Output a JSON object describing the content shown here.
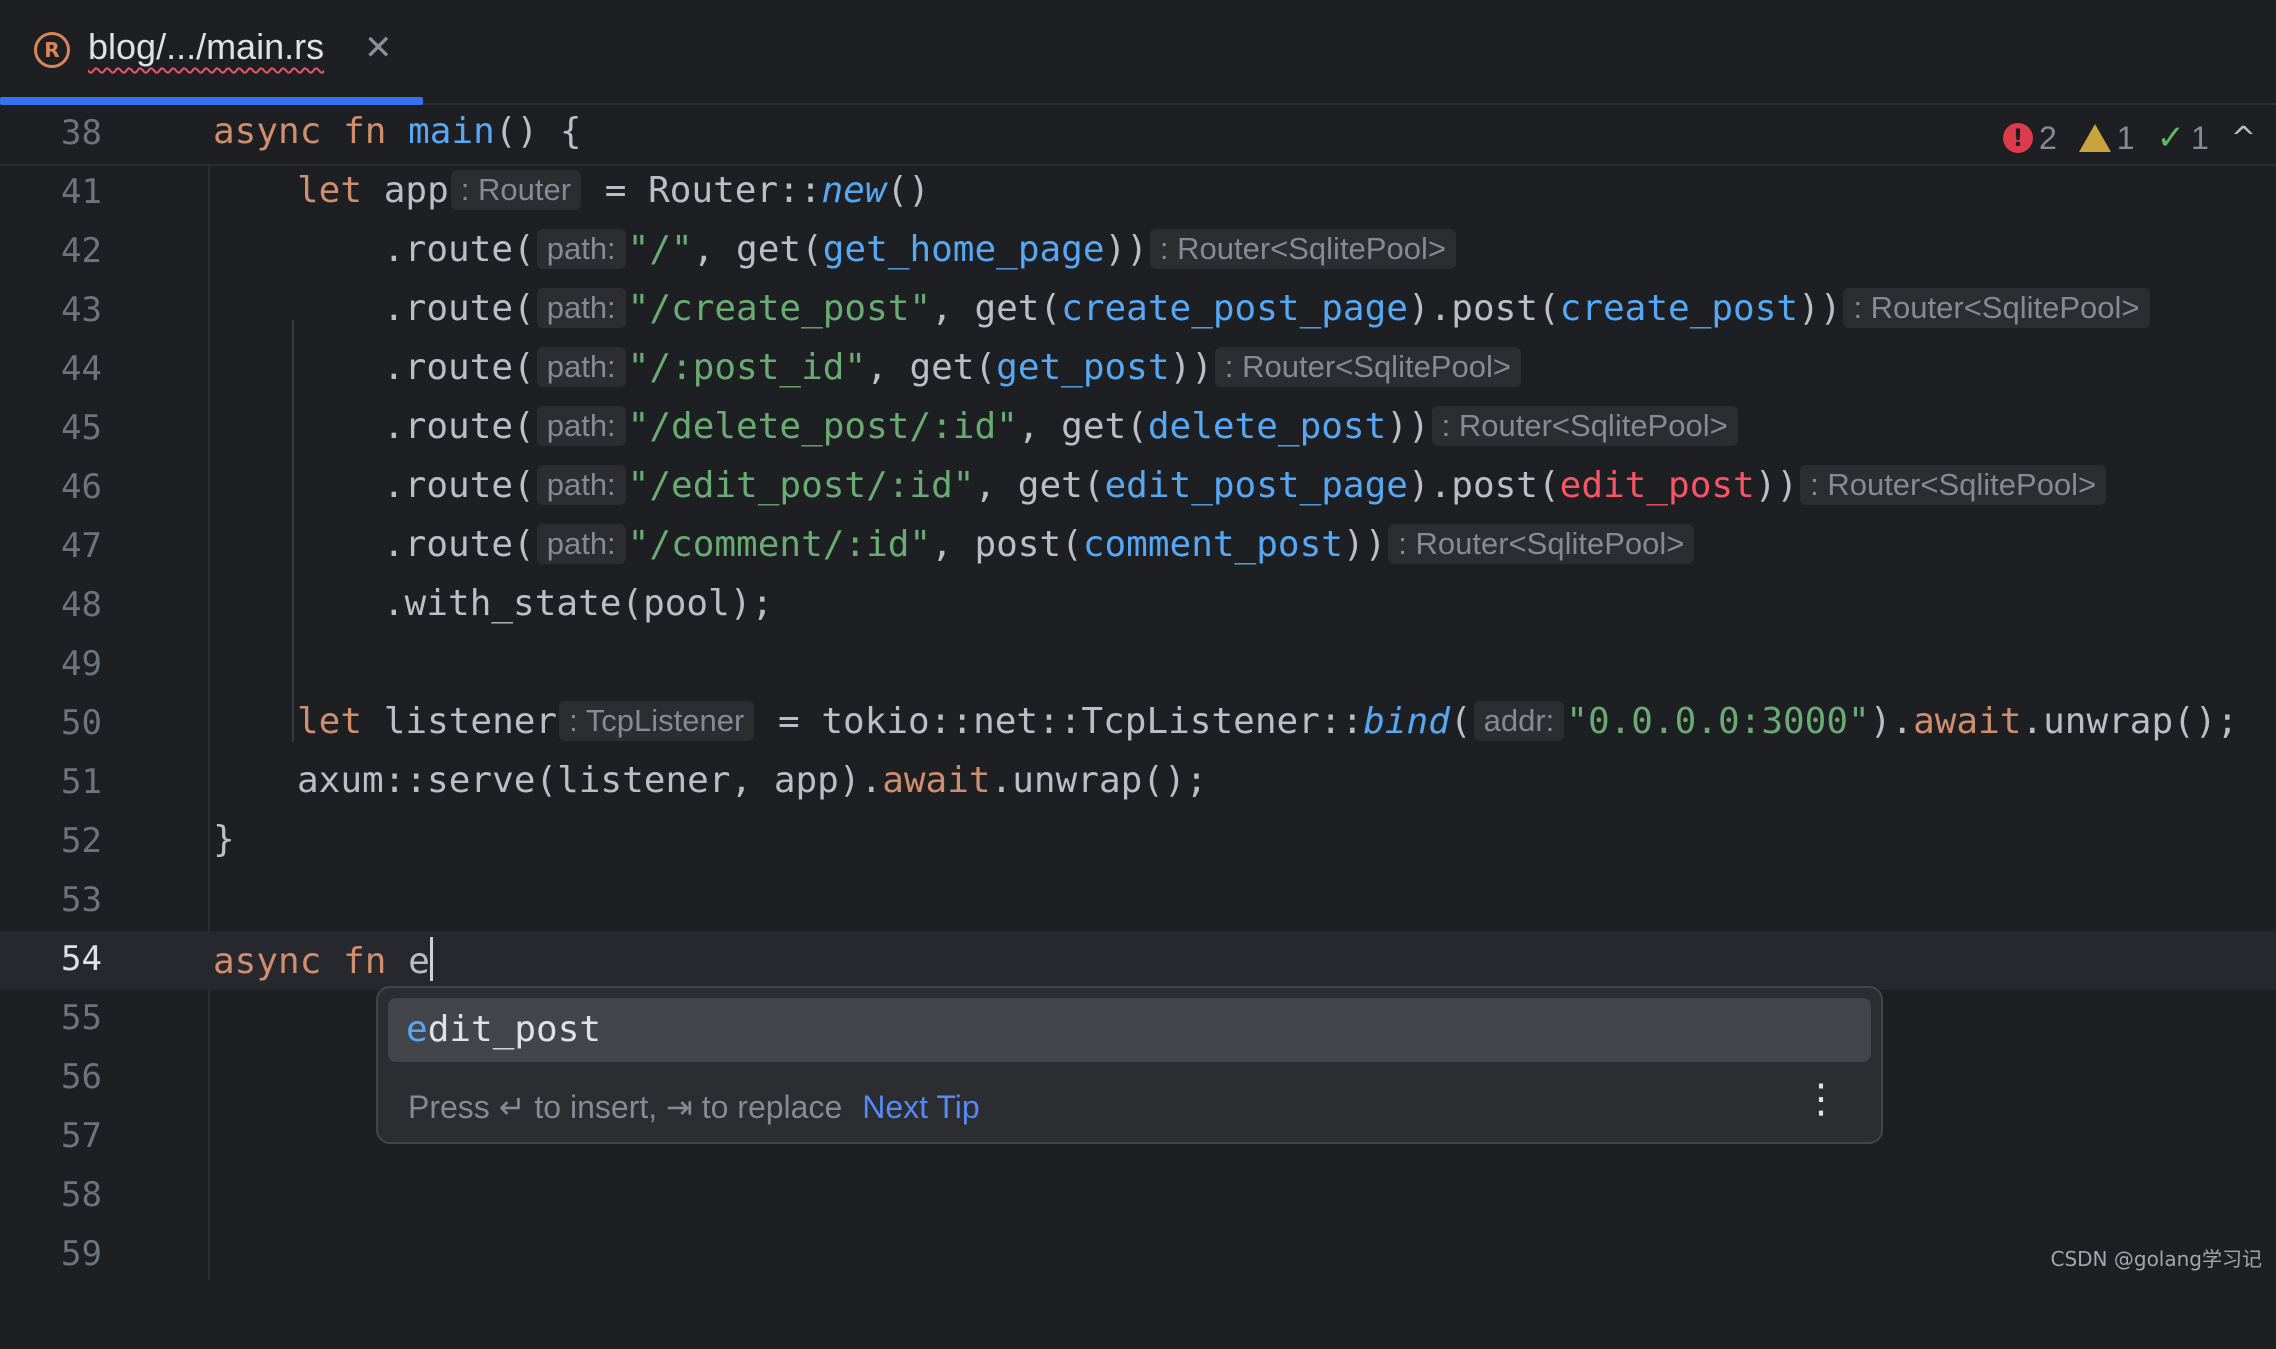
{
  "tab": {
    "icon": "rust-icon",
    "title": "blog/.../main.rs",
    "close": "✕"
  },
  "inspections": {
    "errors": "2",
    "warnings": "1",
    "ok": "1",
    "collapse": "^"
  },
  "lines": {
    "l38": {
      "num": "38",
      "kw1": "async",
      "kw2": "fn",
      "name": "main",
      "rest": "() {"
    },
    "l41": {
      "num": "41",
      "kw": "let",
      "var": "app",
      "hint": ": Router",
      "eq": "= Router::",
      "call": "new",
      "rest": "()"
    },
    "l42": {
      "num": "42",
      "pre": ".route(",
      "hint_path": "path:",
      "str": "\"/\"",
      "mid": ", get(",
      "fn1": "get_home_page",
      "end": "))",
      "type_hint": ": Router<SqlitePool>"
    },
    "l43": {
      "num": "43",
      "pre": ".route(",
      "hint_path": "path:",
      "str": "\"/create_post\"",
      "mid": ", get(",
      "fn1": "create_post_page",
      "mid2": ").post(",
      "fn2": "create_post",
      "end": "))",
      "type_hint": ": Router<SqlitePool>"
    },
    "l44": {
      "num": "44",
      "pre": ".route(",
      "hint_path": "path:",
      "str": "\"/:post_id\"",
      "mid": ", get(",
      "fn1": "get_post",
      "end": "))",
      "type_hint": ": Router<SqlitePool>"
    },
    "l45": {
      "num": "45",
      "pre": ".route(",
      "hint_path": "path:",
      "str": "\"/delete_post/:id\"",
      "mid": ", get(",
      "fn1": "delete_post",
      "end": "))",
      "type_hint": ": Router<SqlitePool>"
    },
    "l46": {
      "num": "46",
      "pre": ".route(",
      "hint_path": "path:",
      "str": "\"/edit_post/:id\"",
      "mid": ", get(",
      "fn1": "edit_post_page",
      "mid2": ").post(",
      "fn2": "edit_post",
      "end": "))",
      "type_hint": ": Router<SqlitePool>"
    },
    "l47": {
      "num": "47",
      "pre": ".route(",
      "hint_path": "path:",
      "str": "\"/comment/:id\"",
      "mid": ", post(",
      "fn1": "comment_post",
      "end": "))",
      "type_hint": ": Router<SqlitePool>"
    },
    "l48": {
      "num": "48",
      "code": ".with_state(pool);"
    },
    "l49": {
      "num": "49"
    },
    "l50": {
      "num": "50",
      "kw": "let",
      "var": "listener",
      "hint": ": TcpListener",
      "eq": "= tokio::net::TcpListener::",
      "call": "bind",
      "open": "(",
      "hint_addr": "addr:",
      "str": "\"0.0.0.0:3000\"",
      "close": ").",
      "await": "await",
      "rest": ".unwrap();"
    },
    "l51": {
      "num": "51",
      "pre": "axum::serve(listener, app).",
      "await": "await",
      "rest": ".unwrap();"
    },
    "l52": {
      "num": "52",
      "code": "}"
    },
    "l53": {
      "num": "53"
    },
    "l54": {
      "num": "54",
      "kw1": "async",
      "kw2": "fn",
      "typed": "e"
    },
    "l55": {
      "num": "55"
    },
    "l56": {
      "num": "56"
    },
    "l57": {
      "num": "57"
    },
    "l58": {
      "num": "58"
    },
    "l59": {
      "num": "59"
    }
  },
  "completion": {
    "match": "e",
    "suggestion_rest": "dit_post",
    "footer": "Press ↵ to insert, ⇥ to replace",
    "next_tip": "Next Tip",
    "more": "⋮"
  },
  "watermark": "CSDN @golang学习记",
  "colors": {
    "keyword": "#cf8e6d",
    "function": "#56a8f5",
    "string": "#6aab73",
    "error_fn": "#f75464",
    "accent": "#3574f0"
  }
}
